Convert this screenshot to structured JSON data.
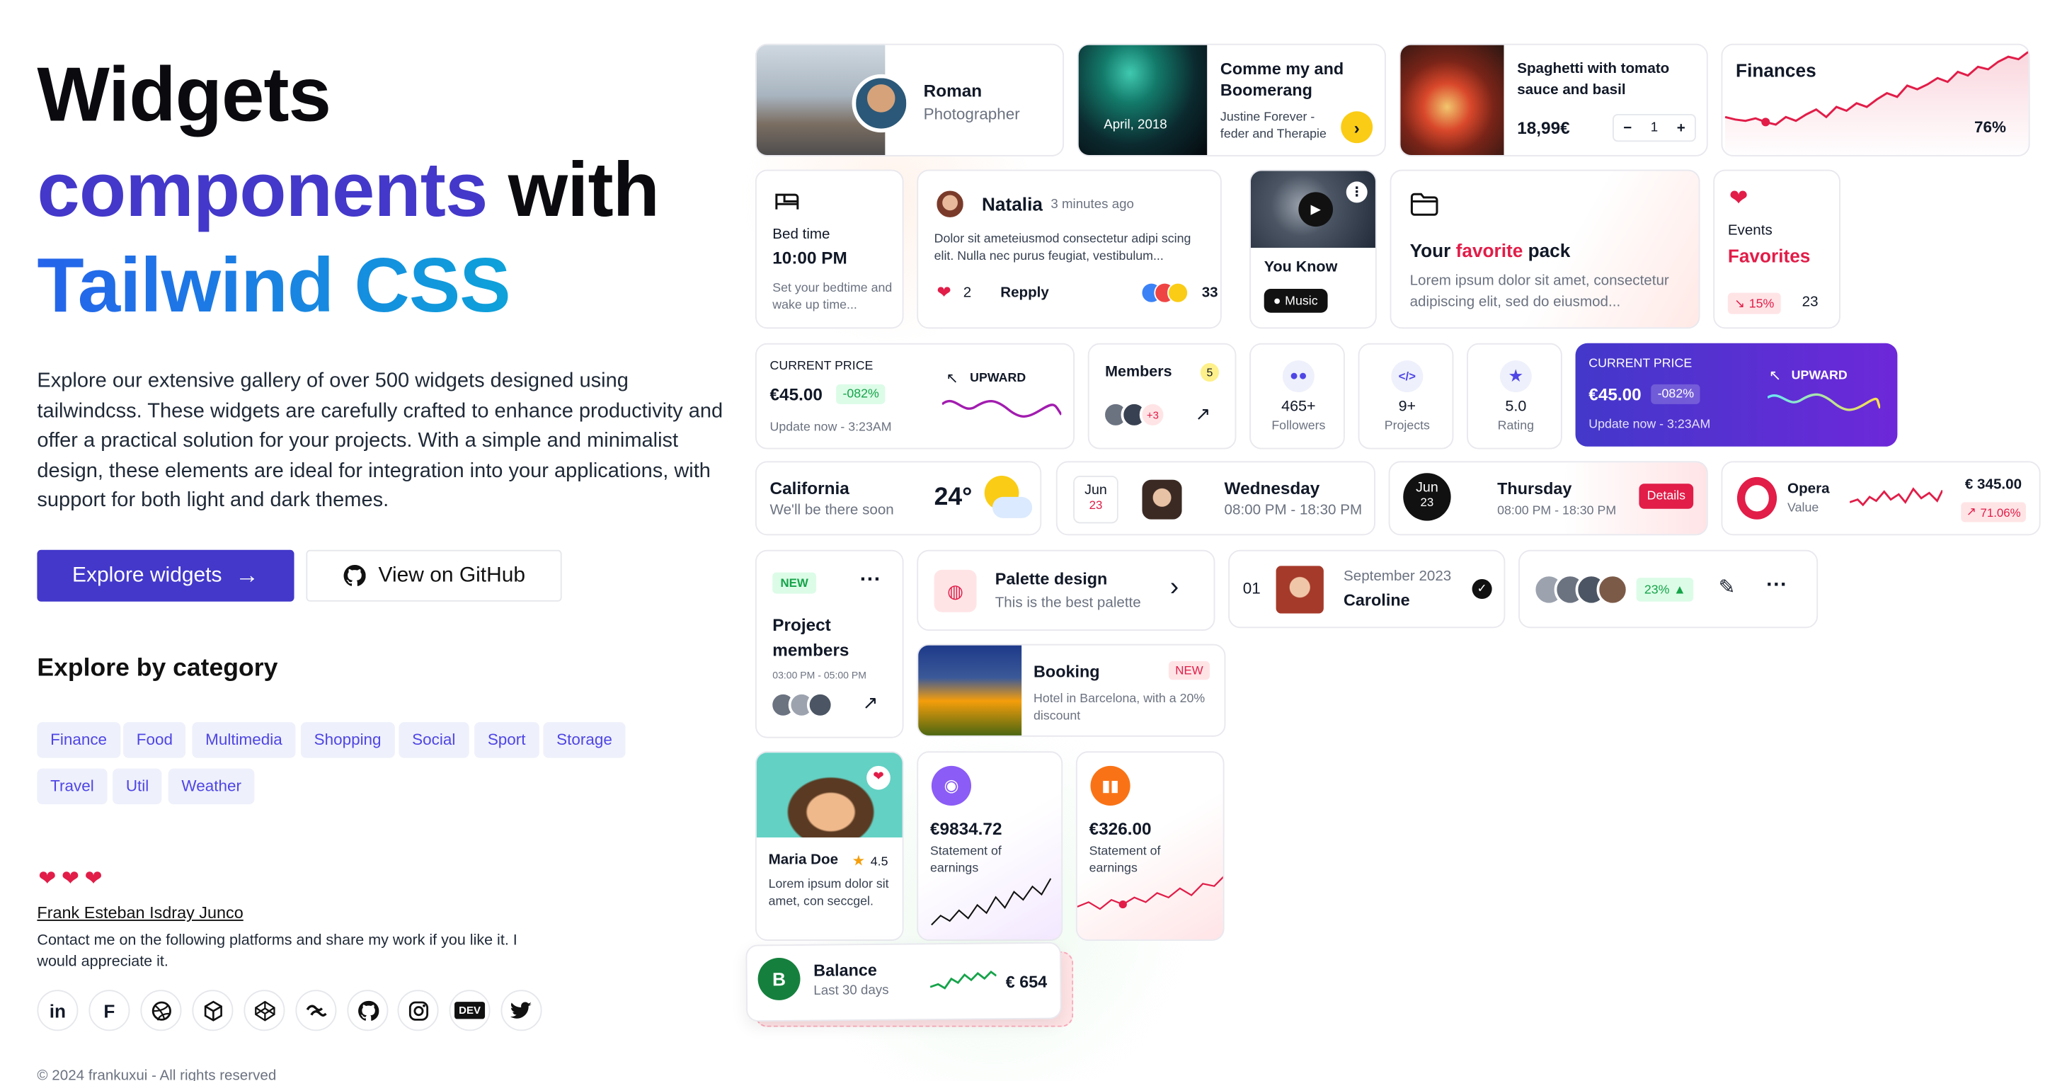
{
  "hero": {
    "title_line1": "Widgets",
    "title_line2a": "components",
    "title_line2b": "with",
    "title_line3": "Tailwind CSS",
    "description": "Explore our extensive gallery of over 500 widgets designed using tailwindcss. These widgets are carefully crafted to enhance productivity and offer a practical solution for your projects. With a simple and minimalist design, these elements are ideal for integration into your applications, with support for both light and dark themes.",
    "primary_button": "Explore widgets",
    "secondary_button": "View on GitHub"
  },
  "categories": {
    "heading": "Explore by category",
    "items": [
      "Finance",
      "Food",
      "Multimedia",
      "Shopping",
      "Social",
      "Sport",
      "Storage",
      "Travel",
      "Util",
      "Weather"
    ]
  },
  "author": {
    "name": "Frank Esteban Isdray Junco",
    "message": "Contact me on the following platforms and share my work if you like it. I would appreciate it.",
    "socials": [
      "linkedin-icon",
      "figma-icon",
      "dribbble-icon",
      "box-icon",
      "codepen-icon",
      "tailwind-icon",
      "github-icon",
      "instagram-icon",
      "dev-icon",
      "twitter-icon"
    ]
  },
  "footer": {
    "copyright": "© 2024 frankuxui - All rights reserved"
  },
  "colors": {
    "primary": "#4338ca",
    "accent": "#06b6d4",
    "heart": "#e11d48",
    "purple_start": "#4338ca",
    "purple_end": "#6d28d9"
  },
  "widgets": {
    "profile": {
      "name": "Roman",
      "role": "Photographer"
    },
    "event": {
      "date": "April, 2018",
      "title": "Comme my and Boomerang",
      "artists": "Justine Forever - feder and Therapie"
    },
    "food": {
      "name": "Spaghetti with tomato sauce and basil",
      "price": "18,99€",
      "qty": "1",
      "minus": "−",
      "plus": "+"
    },
    "finances": {
      "title": "Finances",
      "percent": "76%",
      "series": [
        22,
        20,
        19,
        21,
        18,
        16,
        22,
        19,
        24,
        28,
        22,
        30,
        27,
        33,
        30,
        36,
        41,
        38,
        47,
        44,
        48,
        53,
        50,
        58,
        55,
        62,
        60,
        66,
        70,
        68,
        74
      ]
    },
    "bedtime": {
      "label": "Bed time",
      "time": "10:00 PM",
      "note": "Set your bedtime and wake up time..."
    },
    "post": {
      "author": "Natalia",
      "time": "3 minutes ago",
      "text": "Dolor sit ameteiusmod consectetur adipi scing elit. Nulla nec purus feugiat, vestibulum...",
      "likes": "2",
      "reply": "Repply",
      "reactions": "33"
    },
    "music": {
      "title": "You Know",
      "badge": "Music"
    },
    "pack": {
      "title_a": "Your ",
      "title_b": "favorite",
      "title_c": " pack",
      "text": "Lorem ipsum dolor sit amet, consectetur adipiscing elit, sed do eiusmod..."
    },
    "favorites": {
      "label": "Events",
      "title": "Favorites",
      "change": "15%",
      "count": "23"
    },
    "price1": {
      "label": "CURRENT PRICE",
      "value": "€45.00",
      "change": "-082%",
      "trend": "UPWARD",
      "updated": "Update now - 3:23AM"
    },
    "members": {
      "label": "Members",
      "count": "5",
      "more": "+3"
    },
    "stats": [
      {
        "value": "465+",
        "label": "Followers"
      },
      {
        "value": "9+",
        "label": "Projects"
      },
      {
        "value": "5.0",
        "label": "Rating"
      }
    ],
    "price2": {
      "label": "CURRENT PRICE",
      "value": "€45.00",
      "change": "-082%",
      "trend": "UPWARD",
      "updated": "Update now - 3:23AM"
    },
    "weather": {
      "city": "California",
      "note": "We'll be there soon",
      "temp": "24°"
    },
    "cal1": {
      "month": "Jun",
      "day": "23",
      "weekday": "Wednesday",
      "time": "08:00 PM - 18:30 PM"
    },
    "cal2": {
      "month": "Jun",
      "day": "23",
      "weekday": "Thursday",
      "time": "08:00 PM - 18:30 PM",
      "button": "Details"
    },
    "opera": {
      "name": "Opera",
      "sub": "Value",
      "price": "€ 345.00",
      "change": "71.06%"
    },
    "project": {
      "badge": "NEW",
      "title": "Project members",
      "time": "03:00 PM - 05:00 PM"
    },
    "palette": {
      "title": "Palette design",
      "subtitle": "This is the best palette"
    },
    "contact": {
      "index": "01",
      "date": "September 2023",
      "name": "Caroline"
    },
    "team": {
      "percent": "23%"
    },
    "booking": {
      "title": "Booking",
      "badge": "NEW",
      "text": "Hotel in Barcelona, with a 20% discount"
    },
    "maria": {
      "name": "Maria Doe",
      "rating": "4.5",
      "text": "Lorem ipsum dolor sit amet, con seccgel."
    },
    "earn1": {
      "value": "€9834.72",
      "label": "Statement of earnings",
      "series": [
        5,
        12,
        8,
        16,
        10,
        20,
        14,
        26,
        18,
        30,
        24,
        34,
        28,
        40
      ]
    },
    "earn2": {
      "value": "€326.00",
      "label": "Statement of earnings",
      "series": [
        10,
        12,
        9,
        13,
        11,
        14,
        12,
        16,
        14,
        18,
        15,
        20,
        19,
        24
      ]
    },
    "balance": {
      "initial": "B",
      "title": "Balance",
      "sub": "Last 30 days",
      "value": "€ 654"
    }
  }
}
